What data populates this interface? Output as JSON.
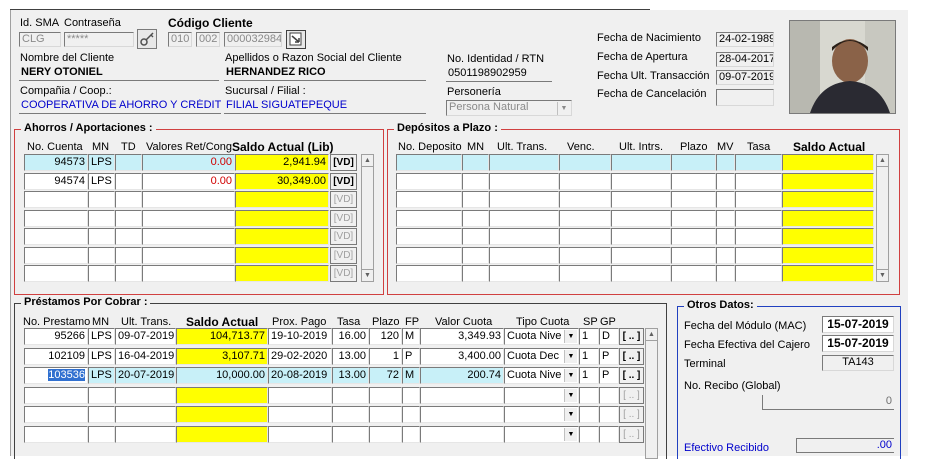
{
  "general": {
    "id_sma_label": "Id. SMA",
    "id_sma": "CLG",
    "password_label": "Contraseña",
    "password": "*****",
    "client_code_label": "Código Cliente",
    "client_code_a": "010",
    "client_code_b": "002",
    "client_code_c": "000032984",
    "name_label": "Nombre del Cliente",
    "name": "NERY OTONIEL",
    "surname_label": "Apellidos o Razon Social del Cliente",
    "surname": "HERNANDEZ RICO",
    "id_label": "No. Identidad / RTN",
    "id_number": "0501198902959",
    "company_label": "Compañia / Coop.:",
    "company": "COOPERATIVA DE AHORRO Y CRÉDITO",
    "branch_label": "Sucursal / Filial :",
    "branch": "FILIAL SIGUATEPEQUE",
    "personeria_label": "Personería",
    "personeria": "Persona Natural",
    "birth_label": "Fecha de Nacimiento",
    "birth": "24-02-1989",
    "opening_label": "Fecha de  Apertura",
    "opening": "28-04-2017",
    "last_tx_label": "Fecha Ult. Transacción",
    "last_tx": "09-07-2019",
    "cancel_label": "Fecha de Cancelación",
    "cancel": ""
  },
  "savings": {
    "title": "Ahorros / Aportaciones :",
    "headers": {
      "account": "No. Cuenta",
      "mn": "MN",
      "td": "TD",
      "ret": "Valores Ret/Cong",
      "balance": "Saldo Actual (Lib)"
    },
    "rows": [
      {
        "account": "94573",
        "mn": "LPS",
        "td": "",
        "ret": "0.00",
        "balance": "2,941.94",
        "btn": "[VD]"
      },
      {
        "account": "94574",
        "mn": "LPS",
        "td": "",
        "ret": "0.00",
        "balance": "30,349.00",
        "btn": "[VD]"
      },
      {
        "account": "",
        "mn": "",
        "td": "",
        "ret": "",
        "balance": "",
        "btn": "[VD]"
      },
      {
        "account": "",
        "mn": "",
        "td": "",
        "ret": "",
        "balance": "",
        "btn": "[VD]"
      },
      {
        "account": "",
        "mn": "",
        "td": "",
        "ret": "",
        "balance": "",
        "btn": "[VD]"
      },
      {
        "account": "",
        "mn": "",
        "td": "",
        "ret": "",
        "balance": "",
        "btn": "[VD]"
      },
      {
        "account": "",
        "mn": "",
        "td": "",
        "ret": "",
        "balance": "",
        "btn": "[VD]"
      }
    ]
  },
  "deposits": {
    "title": "Depósitos a Plazo :",
    "headers": {
      "no": "No. Deposito",
      "mn": "MN",
      "ult": "Ult. Trans.",
      "venc": "Venc.",
      "intrs": "Ult. Intrs.",
      "plazo": "Plazo",
      "mv": "MV",
      "tasa": "Tasa",
      "saldo": "Saldo Actual"
    }
  },
  "loans": {
    "title": "Préstamos Por Cobrar :",
    "headers": {
      "no": "No. Prestamo",
      "mn": "MN",
      "ult": "Ult. Trans.",
      "saldo": "Saldo Actual",
      "prox": "Prox. Pago",
      "tasa": "Tasa",
      "plazo": "Plazo",
      "fp": "FP",
      "cuota": "Valor Cuota",
      "tipo": "Tipo Cuota",
      "sp": "SP",
      "gp": "GP"
    },
    "rows": [
      {
        "no": "95266",
        "mn": "LPS",
        "ult": "09-07-2019",
        "saldo": "104,713.77",
        "prox": "19-10-2019",
        "tasa": "16.00",
        "plazo": "120",
        "fp": "M",
        "cuota": "3,349.93",
        "tipo": "Cuota Nive",
        "sp": "1",
        "gp": "D",
        "btn": "[ .. ]"
      },
      {
        "no": "102109",
        "mn": "LPS",
        "ult": "16-04-2019",
        "saldo": "3,107.71",
        "prox": "29-02-2020",
        "tasa": "13.00",
        "plazo": "1",
        "fp": "P",
        "cuota": "3,400.00",
        "tipo": "Cuota Dec",
        "sp": "1",
        "gp": "P",
        "btn": "[ .. ]"
      },
      {
        "no": "103536",
        "mn": "LPS",
        "ult": "20-07-2019",
        "saldo": "10,000.00",
        "prox": "20-08-2019",
        "tasa": "13.00",
        "plazo": "72",
        "fp": "M",
        "cuota": "200.74",
        "tipo": "Cuota Nive",
        "sp": "1",
        "gp": "P",
        "btn": "[ .. ]"
      },
      {
        "no": "",
        "mn": "",
        "ult": "",
        "saldo": "",
        "prox": "",
        "tasa": "",
        "plazo": "",
        "fp": "",
        "cuota": "",
        "tipo": "",
        "sp": "",
        "gp": "",
        "btn": "[ .. ]"
      },
      {
        "no": "",
        "mn": "",
        "ult": "",
        "saldo": "",
        "prox": "",
        "tasa": "",
        "plazo": "",
        "fp": "",
        "cuota": "",
        "tipo": "",
        "sp": "",
        "gp": "",
        "btn": "[ .. ]"
      },
      {
        "no": "",
        "mn": "",
        "ult": "",
        "saldo": "",
        "prox": "",
        "tasa": "",
        "plazo": "",
        "fp": "",
        "cuota": "",
        "tipo": "",
        "sp": "",
        "gp": "",
        "btn": "[ .. ]"
      }
    ]
  },
  "other": {
    "title": "Otros Datos:",
    "mac_label": "Fecha del Módulo (MAC)",
    "mac": "15-07-2019",
    "cashier_label": "Fecha Efectiva del Cajero",
    "cashier": "15-07-2019",
    "terminal_label": "Terminal",
    "terminal": "TA143",
    "receipt_label": "No. Recibo (Global)",
    "receipt": "0",
    "cash_label": "Efectivo Recibido",
    "cash": ".00"
  },
  "colors": {
    "yellow": "#ffff00",
    "cyan": "#c8f0f8",
    "red_frame": "#d04040",
    "blue_frame": "#2040c0"
  }
}
